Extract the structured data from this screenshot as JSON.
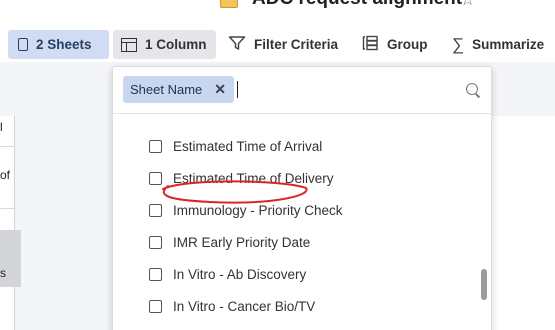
{
  "title": {
    "text": "ADC request alignment",
    "file_icon": "sheet-file-icon",
    "star_icon": "star-outline-icon"
  },
  "toolbar": {
    "sheets_label": "2 Sheets",
    "column_label": "1 Column",
    "filter_label": "Filter Criteria",
    "group_label": "Group",
    "summarize_label": "Summarize"
  },
  "left_grid": {
    "row1": "l",
    "row2": "of",
    "row3": "s"
  },
  "filter_panel": {
    "chip_label": "Sheet Name",
    "search_value": "",
    "options": [
      {
        "label": "Estimated Time of Arrival",
        "checked": false
      },
      {
        "label": "Estimated Time of Delivery",
        "checked": false
      },
      {
        "label": "Immunology - Priority Check",
        "checked": false
      },
      {
        "label": "IMR Early Priority Date",
        "checked": false
      },
      {
        "label": "In Vitro - Ab Discovery",
        "checked": false
      },
      {
        "label": "In Vitro - Cancer Bio/TV",
        "checked": false
      }
    ]
  },
  "colors": {
    "sheets_active_bg": "#cfdcf3",
    "column_active_bg": "#e4e6e9",
    "chip_bg": "#c9d6ef",
    "annotation_red": "#d9262b"
  }
}
